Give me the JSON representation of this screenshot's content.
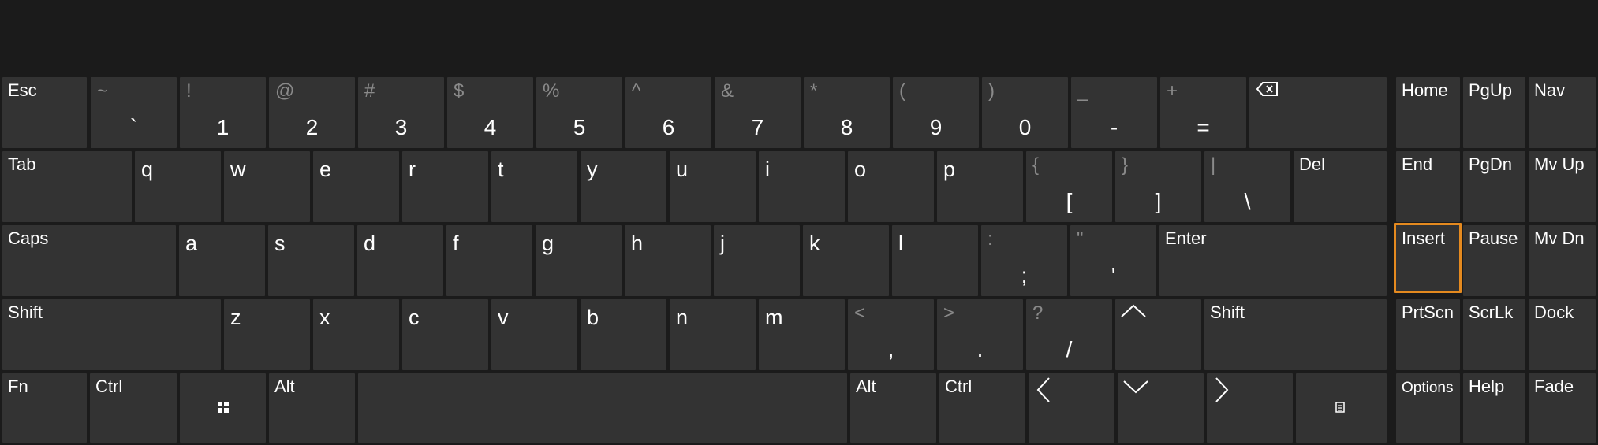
{
  "colors": {
    "background": "#1b1b1b",
    "key": "#333333",
    "text": "#ffffff",
    "secondary_text": "#8a8a8a",
    "selected_outline": "#e58a1f"
  },
  "row1": {
    "esc": "Esc",
    "tilde": {
      "shift": "~",
      "main": "`"
    },
    "d1": {
      "shift": "!",
      "main": "1"
    },
    "d2": {
      "shift": "@",
      "main": "2"
    },
    "d3": {
      "shift": "#",
      "main": "3"
    },
    "d4": {
      "shift": "$",
      "main": "4"
    },
    "d5": {
      "shift": "%",
      "main": "5"
    },
    "d6": {
      "shift": "^",
      "main": "6"
    },
    "d7": {
      "shift": "&",
      "main": "7"
    },
    "d8": {
      "shift": "*",
      "main": "8"
    },
    "d9": {
      "shift": "(",
      "main": "9"
    },
    "d0": {
      "shift": ")",
      "main": "0"
    },
    "minus": {
      "shift": "_",
      "main": "-"
    },
    "equals": {
      "shift": "+",
      "main": "="
    },
    "backspace_icon": "backspace-icon"
  },
  "row2": {
    "tab": "Tab",
    "letters": [
      "q",
      "w",
      "e",
      "r",
      "t",
      "y",
      "u",
      "i",
      "o",
      "p"
    ],
    "lbracket": {
      "shift": "{",
      "main": "["
    },
    "rbracket": {
      "shift": "}",
      "main": "]"
    },
    "backslash": {
      "shift": "|",
      "main": "\\"
    },
    "del": "Del"
  },
  "row3": {
    "caps": "Caps",
    "letters": [
      "a",
      "s",
      "d",
      "f",
      "g",
      "h",
      "j",
      "k",
      "l"
    ],
    "semicolon": {
      "shift": ":",
      "main": ";"
    },
    "quote": {
      "shift": "\"",
      "main": "'"
    },
    "enter": "Enter"
  },
  "row4": {
    "shift_left": "Shift",
    "letters": [
      "z",
      "x",
      "c",
      "v",
      "b",
      "n",
      "m"
    ],
    "comma": {
      "shift": "<",
      "main": ","
    },
    "period": {
      "shift": ">",
      "main": "."
    },
    "slash": {
      "shift": "?",
      "main": "/"
    },
    "up_icon": "caret-up-icon",
    "shift_right": "Shift"
  },
  "row5": {
    "fn": "Fn",
    "ctrl_left": "Ctrl",
    "win_icon": "windows-logo-icon",
    "alt_left": "Alt",
    "alt_right": "Alt",
    "ctrl_right": "Ctrl",
    "left_icon": "caret-left-icon",
    "down_icon": "caret-down-icon",
    "right_icon": "caret-right-icon",
    "menu_icon": "context-menu-icon"
  },
  "nav": {
    "home": "Home",
    "pgup": "PgUp",
    "navkey": "Nav",
    "end": "End",
    "pgdn": "PgDn",
    "mvup": "Mv Up",
    "insert": "Insert",
    "pause": "Pause",
    "mvdn": "Mv Dn",
    "prtscn": "PrtScn",
    "scrlk": "ScrLk",
    "dock": "Dock",
    "options": "Options",
    "help": "Help",
    "fade": "Fade"
  }
}
